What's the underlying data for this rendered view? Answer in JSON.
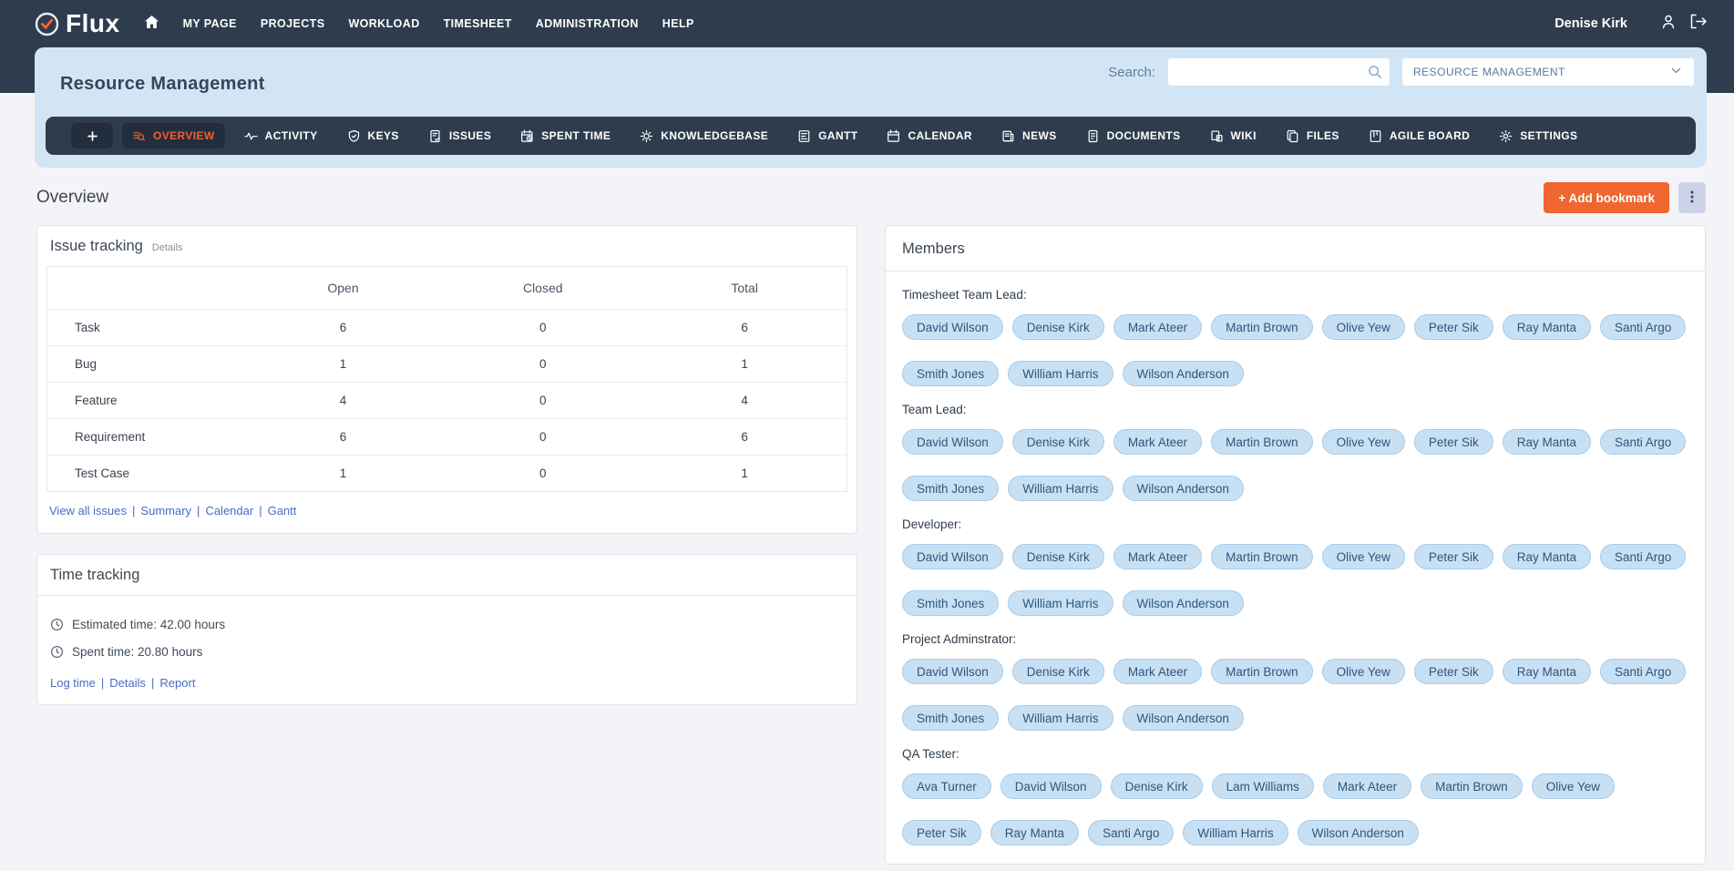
{
  "colors": {
    "navbar_bg": "#2e3c4e",
    "panel_blue": "#d2e5f4",
    "accent_orange": "#f0662e",
    "active_tab_text": "#f0602b",
    "link_blue": "#4a6bc5",
    "pill_bg": "#c8e0f3",
    "page_bg": "#f4f4f8"
  },
  "navbar": {
    "logo_text": "Flux",
    "logo_icon": "check-circle-icon",
    "home_icon": "home-icon",
    "items": [
      "MY PAGE",
      "PROJECTS",
      "WORKLOAD",
      "TIMESHEET",
      "ADMINISTRATION",
      "HELP"
    ],
    "user_name": "Denise Kirk",
    "user_icon": "user-icon",
    "logout_icon": "logout-icon"
  },
  "header": {
    "project_title": "Resource Management",
    "search_label": "Search:",
    "search_value": "",
    "search_icon": "search-icon",
    "project_select_value": "RESOURCE MANAGEMENT",
    "select_chevron_icon": "chevron-down-icon"
  },
  "tabs": [
    {
      "label": "OVERVIEW",
      "icon": "overview",
      "active": true
    },
    {
      "label": "ACTIVITY",
      "icon": "activity",
      "active": false
    },
    {
      "label": "KEYS",
      "icon": "keys",
      "active": false
    },
    {
      "label": "ISSUES",
      "icon": "issues",
      "active": false
    },
    {
      "label": "SPENT TIME",
      "icon": "spent-time",
      "active": false
    },
    {
      "label": "KNOWLEDGEBASE",
      "icon": "knowledgebase",
      "active": false
    },
    {
      "label": "GANTT",
      "icon": "gantt",
      "active": false
    },
    {
      "label": "CALENDAR",
      "icon": "calendar",
      "active": false
    },
    {
      "label": "NEWS",
      "icon": "news",
      "active": false
    },
    {
      "label": "DOCUMENTS",
      "icon": "documents",
      "active": false
    },
    {
      "label": "WIKI",
      "icon": "wiki",
      "active": false
    },
    {
      "label": "FILES",
      "icon": "files",
      "active": false
    },
    {
      "label": "AGILE BOARD",
      "icon": "agile-board",
      "active": false
    },
    {
      "label": "SETTINGS",
      "icon": "settings",
      "active": false
    }
  ],
  "page": {
    "title": "Overview",
    "add_bookmark_label": "+ Add bookmark",
    "kebab_icon": "vertical-dots-icon"
  },
  "issue_tracking": {
    "title": "Issue tracking",
    "details_label": "Details",
    "columns": [
      "Open",
      "Closed",
      "Total"
    ],
    "rows": [
      {
        "name": "Task",
        "open": "6",
        "closed": "0",
        "total": "6"
      },
      {
        "name": "Bug",
        "open": "1",
        "closed": "0",
        "total": "1"
      },
      {
        "name": "Feature",
        "open": "4",
        "closed": "0",
        "total": "4"
      },
      {
        "name": "Requirement",
        "open": "6",
        "closed": "0",
        "total": "6"
      },
      {
        "name": "Test Case",
        "open": "1",
        "closed": "0",
        "total": "1"
      }
    ],
    "links": [
      "View all issues",
      "Summary",
      "Calendar",
      "Gantt"
    ]
  },
  "time_tracking": {
    "title": "Time tracking",
    "item_icon": "clock-icon",
    "items": [
      "Estimated time: 42.00 hours",
      "Spent time: 20.80 hours"
    ],
    "links": [
      "Log time",
      "Details",
      "Report"
    ]
  },
  "members": {
    "title": "Members",
    "groups": [
      {
        "role": "Timesheet Team Lead:",
        "members": [
          "David Wilson",
          "Denise Kirk",
          "Mark Ateer",
          "Martin Brown",
          "Olive Yew",
          "Peter Sik",
          "Ray Manta",
          "Santi Argo",
          "Smith Jones",
          "William Harris",
          "Wilson Anderson"
        ]
      },
      {
        "role": "Team Lead:",
        "members": [
          "David Wilson",
          "Denise Kirk",
          "Mark Ateer",
          "Martin Brown",
          "Olive Yew",
          "Peter Sik",
          "Ray Manta",
          "Santi Argo",
          "Smith Jones",
          "William Harris",
          "Wilson Anderson"
        ]
      },
      {
        "role": "Developer:",
        "members": [
          "David Wilson",
          "Denise Kirk",
          "Mark Ateer",
          "Martin Brown",
          "Olive Yew",
          "Peter Sik",
          "Ray Manta",
          "Santi Argo",
          "Smith Jones",
          "William Harris",
          "Wilson Anderson"
        ]
      },
      {
        "role": "Project Adminstrator:",
        "members": [
          "David Wilson",
          "Denise Kirk",
          "Mark Ateer",
          "Martin Brown",
          "Olive Yew",
          "Peter Sik",
          "Ray Manta",
          "Santi Argo",
          "Smith Jones",
          "William Harris",
          "Wilson Anderson"
        ]
      },
      {
        "role": "QA Tester:",
        "members": [
          "Ava Turner",
          "David Wilson",
          "Denise Kirk",
          "Lam Williams",
          "Mark Ateer",
          "Martin Brown",
          "Olive Yew",
          "Peter Sik",
          "Ray Manta",
          "Santi Argo",
          "William Harris",
          "Wilson Anderson"
        ]
      }
    ]
  }
}
